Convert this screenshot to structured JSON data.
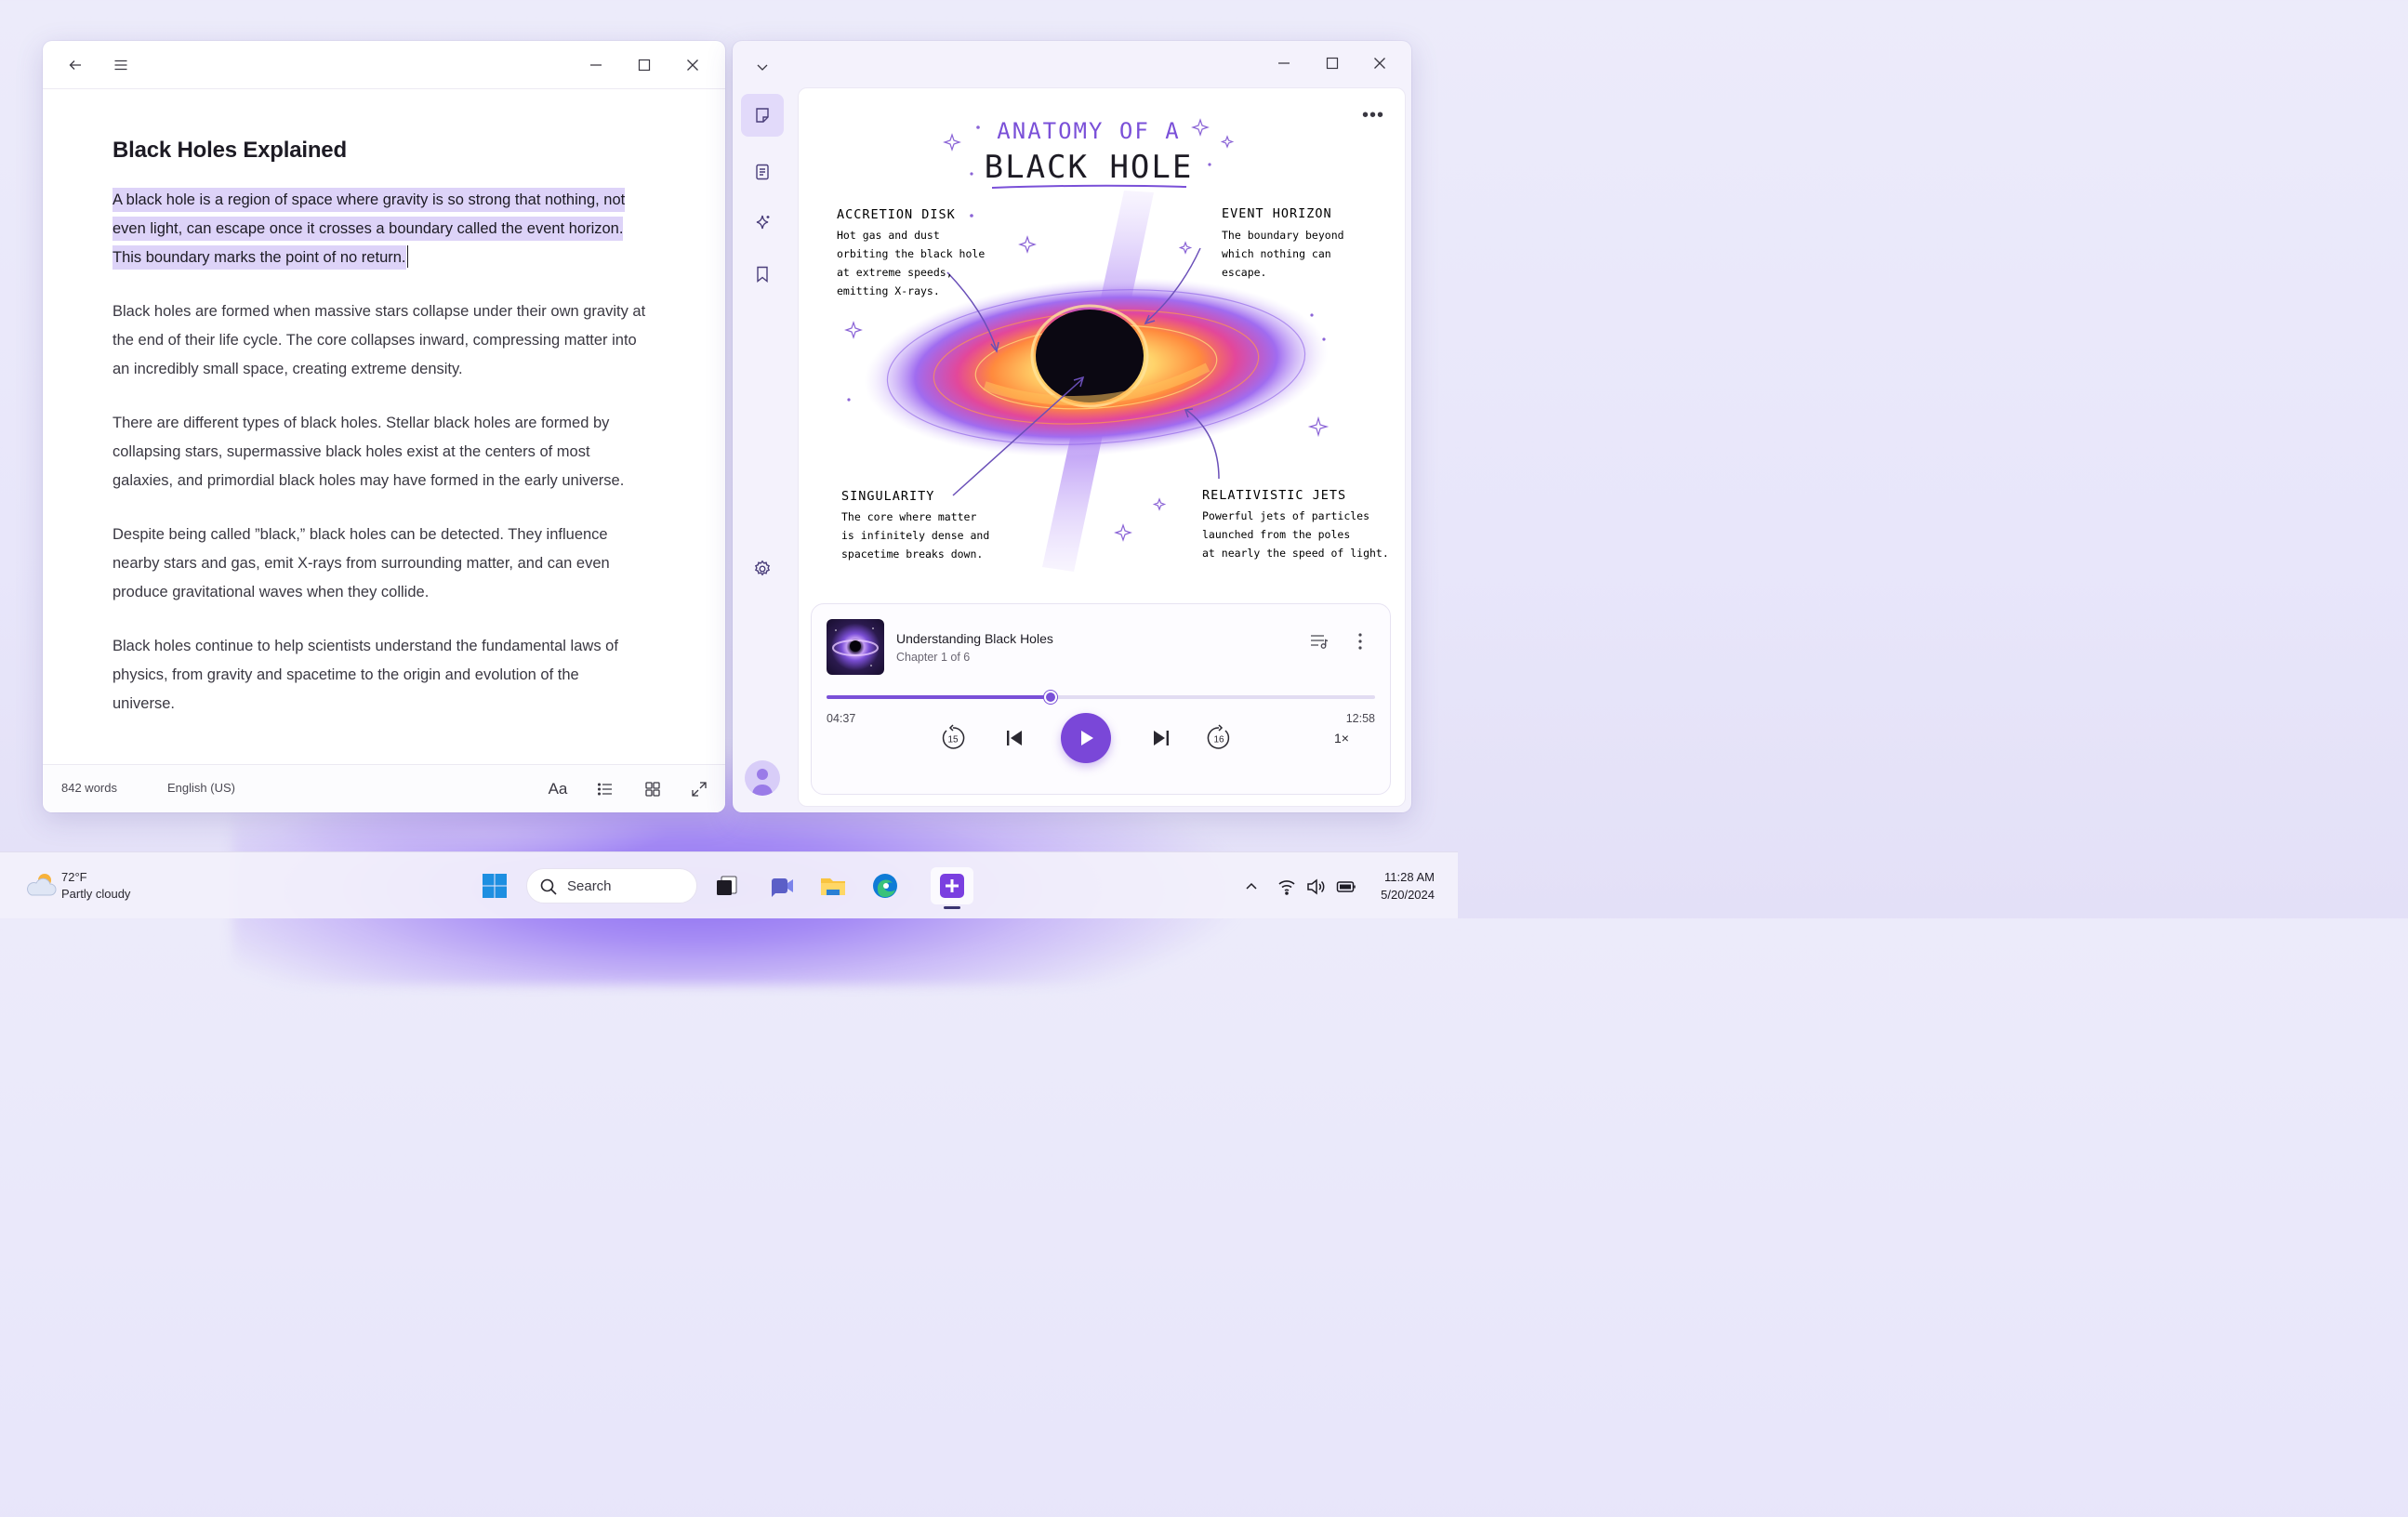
{
  "editor": {
    "title": "Black Holes Explained",
    "selected_paragraph": "A black hole is a region of space where gravity is so strong that nothing, not even light, can escape once it crosses a boundary called the event horizon. This boundary marks the point of no return.",
    "paragraphs": [
      "Black holes are formed when massive stars collapse under their own gravity at the end of their life cycle. The core collapses inward, compressing matter into an incredibly small space, creating extreme density.",
      "There are different types of black holes. Stellar black holes are formed by collapsing stars, supermassive black holes exist at the centers of most galaxies, and primordial black holes may have formed in the early universe.",
      "Despite being called ”black,” black holes can be detected. They influence nearby stars and gas, emit X-rays from surrounding matter, and can even produce gravitational waves when they collide.",
      "Black holes continue to help scientists understand the fundamental laws of physics, from gravity and spacetime to the origin and evolution of the universe."
    ],
    "status": {
      "word_count": "842 words",
      "language": "English (US)",
      "font_label": "Aa"
    }
  },
  "illustration": {
    "title_line1": "ANATOMY OF A",
    "title_line2": "BLACK HOLE",
    "labels": [
      {
        "heading": "ACCRETION DISK",
        "lines": [
          "Hot gas and dust",
          "orbiting the black hole",
          "at extreme speeds,",
          "emitting X-rays."
        ]
      },
      {
        "heading": "EVENT HORIZON",
        "lines": [
          "The boundary beyond",
          "which nothing can",
          "escape."
        ]
      },
      {
        "heading": "SINGULARITY",
        "lines": [
          "The core where matter",
          "is infinitely dense and",
          "spacetime breaks down."
        ]
      },
      {
        "heading": "RELATIVISTIC JETS",
        "lines": [
          "Powerful jets of particles",
          "launched from the poles",
          "at nearly the speed of light."
        ]
      }
    ]
  },
  "player": {
    "title": "Understanding Black Holes",
    "chapter": "Chapter 1 of 6",
    "elapsed": "04:37",
    "duration": "12:58",
    "progress": 0.408,
    "skip_back": "15",
    "skip_forward": "16",
    "speed": "1×"
  },
  "taskbar": {
    "temperature": "72°F",
    "weather": "Partly cloudy",
    "search_label": "Search",
    "time": "11:28 AM",
    "date": "5/20/2024"
  },
  "colors": {
    "accent": "#7a47d8",
    "selection": "#ddd3f8",
    "rail_active": "#e2dafa"
  },
  "icons": [
    "back-arrow-icon",
    "menu-icon",
    "minimize-icon",
    "maximize-icon",
    "close-icon",
    "chevron-down-icon",
    "notes-icon",
    "document-icon",
    "sparkle-icon",
    "bookmark-icon",
    "settings-icon",
    "playlist-icon",
    "more-vertical-icon",
    "previous-icon",
    "play-icon",
    "next-icon",
    "list-icon",
    "grid-icon",
    "expand-icon",
    "wifi-icon",
    "volume-icon",
    "battery-icon"
  ]
}
